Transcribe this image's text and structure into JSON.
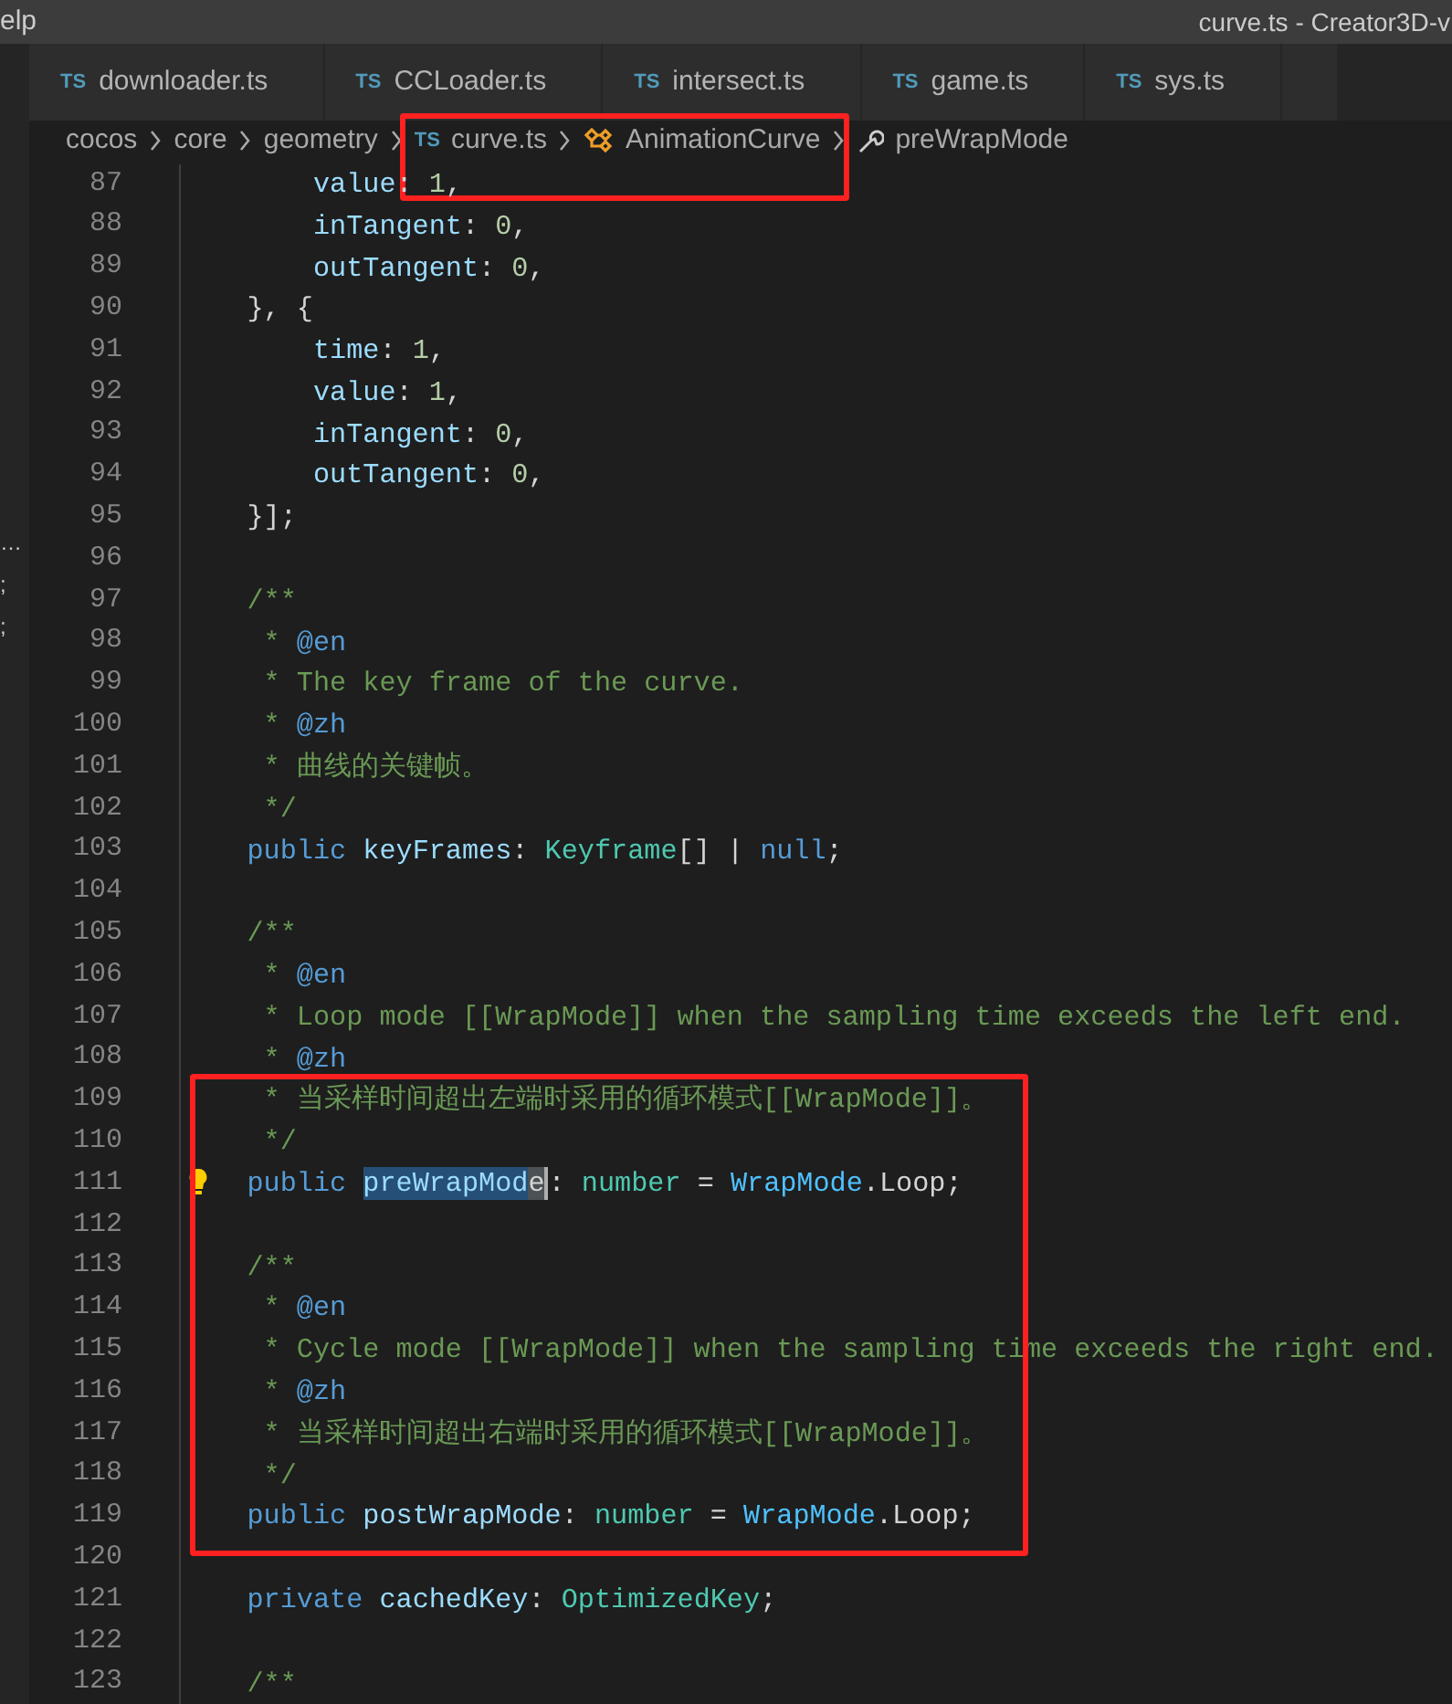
{
  "window": {
    "menu_fragment": "elp",
    "title": "curve.ts - Creator3D-v"
  },
  "tabs": [
    {
      "badge": "TS",
      "label": "downloader.ts",
      "selected": false
    },
    {
      "badge": "TS",
      "label": "CCLoader.ts",
      "selected": false
    },
    {
      "badge": "TS",
      "label": "intersect.ts",
      "selected": false
    },
    {
      "badge": "TS",
      "label": "game.ts",
      "selected": false
    },
    {
      "badge": "TS",
      "label": "sys.ts",
      "selected": false
    }
  ],
  "breadcrumb": [
    {
      "kind": "folder",
      "label": "cocos",
      "boxed": false
    },
    {
      "kind": "folder",
      "label": "core",
      "boxed": false
    },
    {
      "kind": "folder",
      "label": "geometry",
      "boxed": false
    },
    {
      "kind": "file",
      "badge": "TS",
      "label": "curve.ts",
      "boxed": true
    },
    {
      "kind": "class",
      "label": "AnimationCurve",
      "boxed": true
    },
    {
      "kind": "property",
      "label": "preWrapMode",
      "boxed": false
    }
  ],
  "sidebar": {
    "items": [
      "…",
      ";",
      ";"
    ]
  },
  "code_lines": [
    {
      "number": "87",
      "boxed": false,
      "tokens": [
        {
          "text": "        value",
          "kind": "prop"
        },
        {
          "text": ": ",
          "kind": "plain"
        },
        {
          "text": "1",
          "kind": "num"
        },
        {
          "text": ",",
          "kind": "plain"
        }
      ]
    },
    {
      "number": "88",
      "boxed": false,
      "tokens": [
        {
          "text": "        inTangent",
          "kind": "prop"
        },
        {
          "text": ": ",
          "kind": "plain"
        },
        {
          "text": "0",
          "kind": "num"
        },
        {
          "text": ",",
          "kind": "plain"
        }
      ]
    },
    {
      "number": "89",
      "boxed": false,
      "tokens": [
        {
          "text": "        outTangent",
          "kind": "prop"
        },
        {
          "text": ": ",
          "kind": "plain"
        },
        {
          "text": "0",
          "kind": "num"
        },
        {
          "text": ",",
          "kind": "plain"
        }
      ]
    },
    {
      "number": "90",
      "boxed": false,
      "tokens": [
        {
          "text": "    }, {",
          "kind": "plain"
        }
      ]
    },
    {
      "number": "91",
      "boxed": false,
      "tokens": [
        {
          "text": "        time",
          "kind": "prop"
        },
        {
          "text": ": ",
          "kind": "plain"
        },
        {
          "text": "1",
          "kind": "num"
        },
        {
          "text": ",",
          "kind": "plain"
        }
      ]
    },
    {
      "number": "92",
      "boxed": false,
      "tokens": [
        {
          "text": "        value",
          "kind": "prop"
        },
        {
          "text": ": ",
          "kind": "plain"
        },
        {
          "text": "1",
          "kind": "num"
        },
        {
          "text": ",",
          "kind": "plain"
        }
      ]
    },
    {
      "number": "93",
      "boxed": false,
      "tokens": [
        {
          "text": "        inTangent",
          "kind": "prop"
        },
        {
          "text": ": ",
          "kind": "plain"
        },
        {
          "text": "0",
          "kind": "num"
        },
        {
          "text": ",",
          "kind": "plain"
        }
      ]
    },
    {
      "number": "94",
      "boxed": false,
      "tokens": [
        {
          "text": "        outTangent",
          "kind": "prop"
        },
        {
          "text": ": ",
          "kind": "plain"
        },
        {
          "text": "0",
          "kind": "num"
        },
        {
          "text": ",",
          "kind": "plain"
        }
      ]
    },
    {
      "number": "95",
      "boxed": false,
      "tokens": [
        {
          "text": "    }];",
          "kind": "plain"
        }
      ]
    },
    {
      "number": "96",
      "boxed": false
    },
    {
      "number": "97",
      "boxed": false,
      "tokens": [
        {
          "text": "    /**",
          "kind": "com"
        }
      ]
    },
    {
      "number": "98",
      "boxed": false,
      "tokens": [
        {
          "text": "     * ",
          "kind": "com"
        },
        {
          "text": "@en",
          "kind": "tag"
        }
      ]
    },
    {
      "number": "99",
      "boxed": false,
      "tokens": [
        {
          "text": "     * The key frame of the curve.",
          "kind": "com"
        }
      ]
    },
    {
      "number": "100",
      "boxed": false,
      "tokens": [
        {
          "text": "     * ",
          "kind": "com"
        },
        {
          "text": "@zh",
          "kind": "tag"
        }
      ]
    },
    {
      "number": "101",
      "boxed": false,
      "tokens": [
        {
          "text": "     * 曲线的关键帧。",
          "kind": "com"
        }
      ]
    },
    {
      "number": "102",
      "boxed": false,
      "tokens": [
        {
          "text": "     */",
          "kind": "com"
        }
      ]
    },
    {
      "number": "103",
      "boxed": false,
      "tokens": [
        {
          "text": "    public ",
          "kind": "kw"
        },
        {
          "text": "keyFrames",
          "kind": "prop"
        },
        {
          "text": ": ",
          "kind": "plain"
        },
        {
          "text": "Keyframe",
          "kind": "type"
        },
        {
          "text": "[] | ",
          "kind": "plain"
        },
        {
          "text": "null",
          "kind": "kw"
        },
        {
          "text": ";",
          "kind": "plain"
        }
      ]
    },
    {
      "number": "104",
      "boxed": false
    },
    {
      "number": "105",
      "boxed": false,
      "tokens": [
        {
          "text": "    /**",
          "kind": "com"
        }
      ]
    },
    {
      "number": "106",
      "boxed": false,
      "tokens": [
        {
          "text": "     * ",
          "kind": "com"
        },
        {
          "text": "@en",
          "kind": "tag"
        }
      ]
    },
    {
      "number": "107",
      "boxed": false,
      "tokens": [
        {
          "text": "     * Loop mode [[WrapMode]] when the sampling time exceeds the left end.",
          "kind": "com"
        }
      ]
    },
    {
      "number": "108",
      "boxed": false,
      "tokens": [
        {
          "text": "     * ",
          "kind": "com"
        },
        {
          "text": "@zh",
          "kind": "tag"
        }
      ]
    },
    {
      "number": "109",
      "boxed": true,
      "tokens": [
        {
          "text": "     * 当采样时间超出左端时采用的循环模式[[WrapMode]]。",
          "kind": "com"
        }
      ]
    },
    {
      "number": "110",
      "boxed": true,
      "tokens": [
        {
          "text": "     */",
          "kind": "com"
        }
      ]
    },
    {
      "number": "111",
      "boxed": true,
      "lightbulb": true,
      "tokens": [
        {
          "text": "    public ",
          "kind": "kw",
          "selected": false,
          "word_highlight": false
        },
        {
          "text": "preWrapMod",
          "kind": "prop",
          "selected": true,
          "word_highlight": false
        },
        {
          "text": "e",
          "kind": "prop",
          "selected": false,
          "word_highlight": true
        },
        {
          "text": ": ",
          "kind": "plain",
          "selected": false,
          "word_highlight": false
        },
        {
          "text": "number",
          "kind": "type",
          "selected": false,
          "word_highlight": false
        },
        {
          "text": " = ",
          "kind": "plain",
          "selected": false,
          "word_highlight": false
        },
        {
          "text": "WrapMode",
          "kind": "enum",
          "selected": false,
          "word_highlight": false
        },
        {
          "text": ".Loop;",
          "kind": "plain",
          "selected": false,
          "word_highlight": false
        }
      ]
    },
    {
      "number": "112",
      "boxed": true
    },
    {
      "number": "113",
      "boxed": true,
      "tokens": [
        {
          "text": "    /**",
          "kind": "com"
        }
      ]
    },
    {
      "number": "114",
      "boxed": true,
      "tokens": [
        {
          "text": "     * ",
          "kind": "com"
        },
        {
          "text": "@en",
          "kind": "tag"
        }
      ]
    },
    {
      "number": "115",
      "boxed": true,
      "tokens": [
        {
          "text": "     * Cycle mode [[WrapMode]] when the sampling time exceeds the right end.",
          "kind": "com"
        }
      ]
    },
    {
      "number": "116",
      "boxed": true,
      "tokens": [
        {
          "text": "     * ",
          "kind": "com"
        },
        {
          "text": "@zh",
          "kind": "tag"
        }
      ]
    },
    {
      "number": "117",
      "boxed": true,
      "tokens": [
        {
          "text": "     * 当采样时间超出右端时采用的循环模式[[WrapMode]]。",
          "kind": "com"
        }
      ]
    },
    {
      "number": "118",
      "boxed": true,
      "tokens": [
        {
          "text": "     */",
          "kind": "com"
        }
      ]
    },
    {
      "number": "119",
      "boxed": true,
      "tokens": [
        {
          "text": "    public ",
          "kind": "kw"
        },
        {
          "text": "postWrapMode",
          "kind": "prop"
        },
        {
          "text": ": ",
          "kind": "plain"
        },
        {
          "text": "number",
          "kind": "type"
        },
        {
          "text": " = ",
          "kind": "plain"
        },
        {
          "text": "WrapMode",
          "kind": "enum"
        },
        {
          "text": ".Loop;",
          "kind": "plain"
        }
      ]
    },
    {
      "number": "120",
      "boxed": false
    },
    {
      "number": "121",
      "boxed": false,
      "tokens": [
        {
          "text": "    private ",
          "kind": "kw"
        },
        {
          "text": "cachedKey",
          "kind": "prop"
        },
        {
          "text": ": ",
          "kind": "plain"
        },
        {
          "text": "OptimizedKey",
          "kind": "type"
        },
        {
          "text": ";",
          "kind": "plain"
        }
      ]
    },
    {
      "number": "122",
      "boxed": false
    },
    {
      "number": "123",
      "boxed": false,
      "tokens": [
        {
          "text": "    /**",
          "kind": "com"
        }
      ]
    }
  ]
}
